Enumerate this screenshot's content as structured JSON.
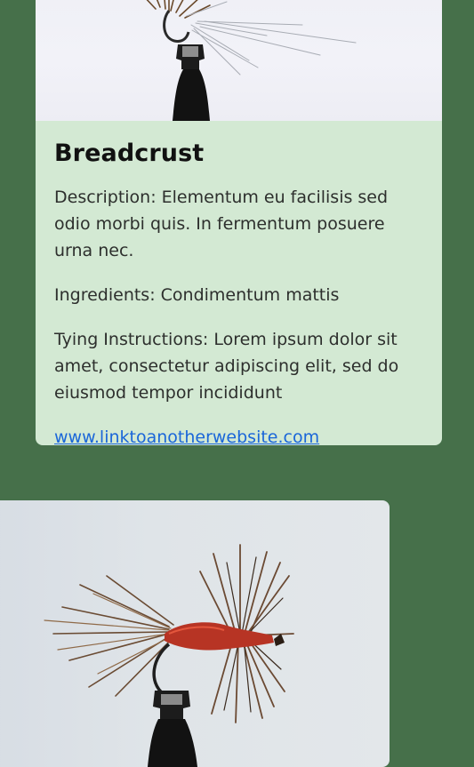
{
  "card_top": {
    "title": "Breadcrust",
    "description": "Description: Elementum eu facilisis sed odio morbi quis. In fermentum posuere urna nec.",
    "ingredients": "Ingredients: Condimentum mattis",
    "tying_instructions": "Tying Instructions: Lorem ipsum dolor sit amet, consectetur adipiscing elit, sed do eiusmod tempor incididunt",
    "link_text": "www.linktoanotherwebsite.com",
    "image_icon": "fly-photo-icon"
  },
  "card_bottom": {
    "image_icon": "fly-photo-icon"
  },
  "colors": {
    "page_background": "#46704a",
    "card_background": "#d3e9d3",
    "link": "#1a66d9"
  }
}
